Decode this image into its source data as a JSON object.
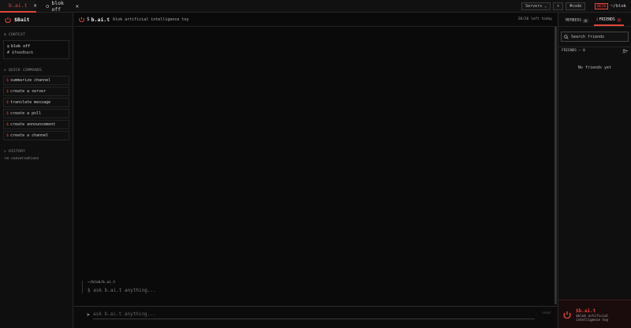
{
  "tabs": [
    {
      "label": "b.ai.t",
      "active": true
    },
    {
      "label": "blok off",
      "active": false
    }
  ],
  "topbar": {
    "servers_label": "Servers ⌄",
    "plus_label": "+",
    "code_label": "#code",
    "beta_label": "BETA",
    "path": "~/blok"
  },
  "left": {
    "title": "$Bait",
    "context_title": "$ CONTEXT",
    "context_server": "blok off",
    "context_channel": "# $feedback",
    "quick_title": "> QUICK COMMANDS",
    "commands": [
      "summarize channel",
      "create a server",
      "translate message",
      "create a poll",
      "create announcement",
      "create a channel"
    ],
    "history_title": "> HISTORY",
    "history_empty": "no conversations"
  },
  "main": {
    "prefix": "$",
    "title": "b.ai.t",
    "subtitle": "blok artificial intelligence toy",
    "limit": "20/20 left today",
    "prompt_path": "~/blok/b.ai.t",
    "prompt_text": "$ ask b.ai.t anything...",
    "input_caret": ">",
    "input_placeholder": "ask b.ai.t anything...",
    "send_label": "send"
  },
  "right": {
    "tab_members": "MEMBERS",
    "members_count": "0",
    "tab_friends": "FRIENDS",
    "friends_count": "0",
    "search_placeholder": "Search friends",
    "friends_header": "FRIENDS — 0",
    "no_friends": "No friends yet",
    "footer_name": "$b.ai.t",
    "footer_desc": "$blok artificial intelligence toy"
  },
  "colors": {
    "accent": "#e0443a",
    "bg": "#0a0a0a"
  }
}
